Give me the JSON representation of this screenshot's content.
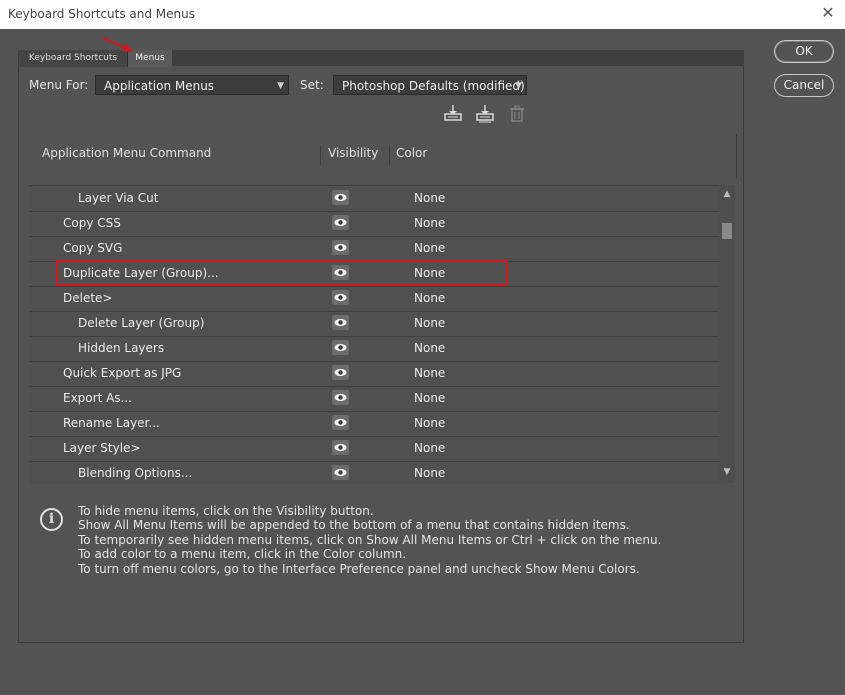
{
  "window": {
    "title": "Keyboard Shortcuts and Menus",
    "close_glyph": "✕"
  },
  "tabs": [
    {
      "label": "Keyboard Shortcuts"
    },
    {
      "label": "Menus"
    }
  ],
  "menu_for": {
    "label": "Menu For:",
    "value": "Application Menus"
  },
  "set": {
    "label": "Set:",
    "value": "Photoshop Defaults (modified)"
  },
  "toolbar_icons": [
    "save-set-icon",
    "save-as-set-icon",
    "delete-set-icon"
  ],
  "table": {
    "columns": [
      "Application Menu Command",
      "Visibility",
      "Color"
    ],
    "rows": [
      {
        "command": "Layer Via Cut",
        "indent": 2,
        "color": "None"
      },
      {
        "command": "Copy CSS",
        "indent": 1,
        "color": "None"
      },
      {
        "command": "Copy SVG",
        "indent": 1,
        "color": "None"
      },
      {
        "command": "Duplicate Layer (Group)...",
        "indent": 1,
        "color": "None"
      },
      {
        "command": "Delete>",
        "indent": 1,
        "color": "None"
      },
      {
        "command": "Delete Layer (Group)",
        "indent": 2,
        "color": "None"
      },
      {
        "command": "Hidden Layers",
        "indent": 2,
        "color": "None"
      },
      {
        "command": "Quick Export as JPG",
        "indent": 1,
        "color": "None"
      },
      {
        "command": "Export As...",
        "indent": 1,
        "color": "None"
      },
      {
        "command": "Rename Layer...",
        "indent": 1,
        "color": "None"
      },
      {
        "command": "Layer Style>",
        "indent": 1,
        "color": "None"
      },
      {
        "command": "Blending Options...",
        "indent": 2,
        "color": "None"
      }
    ]
  },
  "info": {
    "icon": "info-icon",
    "lines": [
      "To hide menu items, click on the Visibility button.",
      "Show All Menu Items will be appended to the bottom of a menu that contains hidden items.",
      "To temporarily see hidden menu items, click on Show All Menu Items or Ctrl + click on the menu.",
      "To add color to a menu item, click in the Color column.",
      "To turn off menu colors, go to the Interface Preference panel and uncheck Show Menu Colors."
    ]
  },
  "buttons": {
    "ok": "OK",
    "cancel": "Cancel"
  },
  "colors": {
    "background": "#535353",
    "highlight": "#d9151b",
    "arrow": "#d9151b"
  }
}
